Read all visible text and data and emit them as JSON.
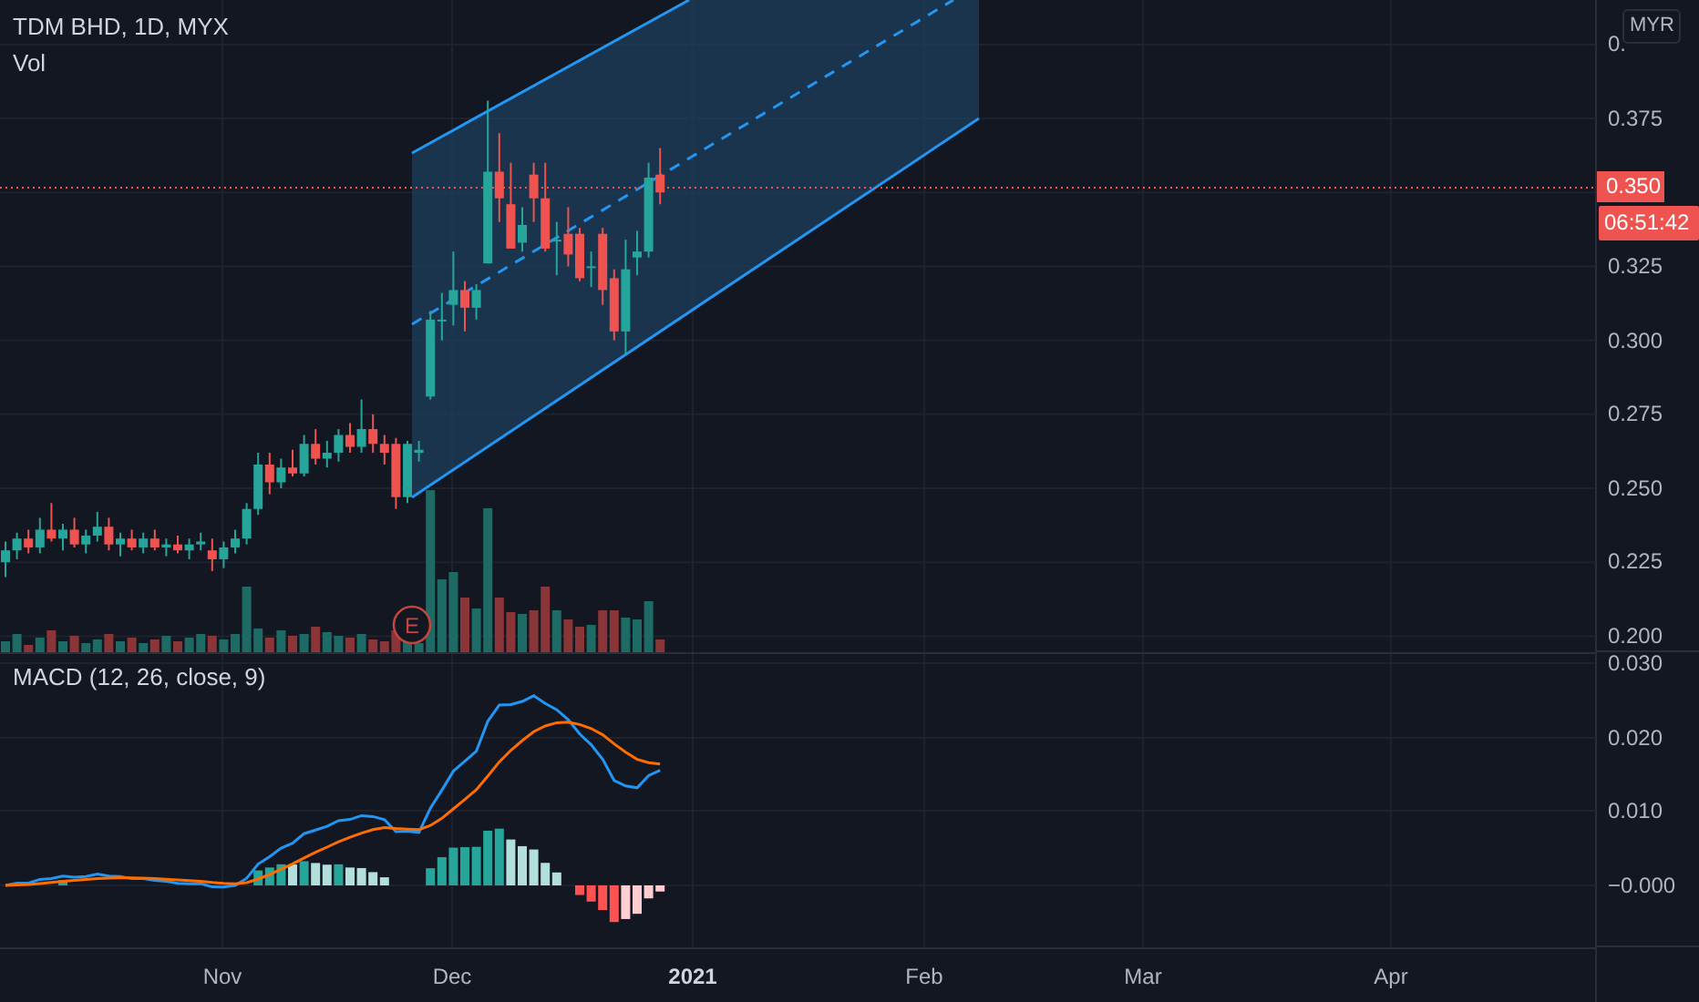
{
  "legend": {
    "symbol": "TDM BHD, 1D, MYX",
    "volume_label": "Vol"
  },
  "price_axis": {
    "currency": "MYR",
    "ticks_above": [
      "0.",
      "0.375"
    ],
    "last_price": "0.350",
    "countdown": "06:51:42",
    "ticks_below": [
      "0.325",
      "0.300",
      "0.275",
      "0.250",
      "0.225",
      "0.200"
    ]
  },
  "earnings_marker": "E",
  "macd": {
    "title": "MACD (12, 26, close, 9)",
    "ticks": [
      "0.030",
      "0.020",
      "0.010",
      "−0.000"
    ]
  },
  "time_axis": [
    "Nov",
    "Dec",
    "2021",
    "Feb",
    "Mar",
    "Apr"
  ]
}
